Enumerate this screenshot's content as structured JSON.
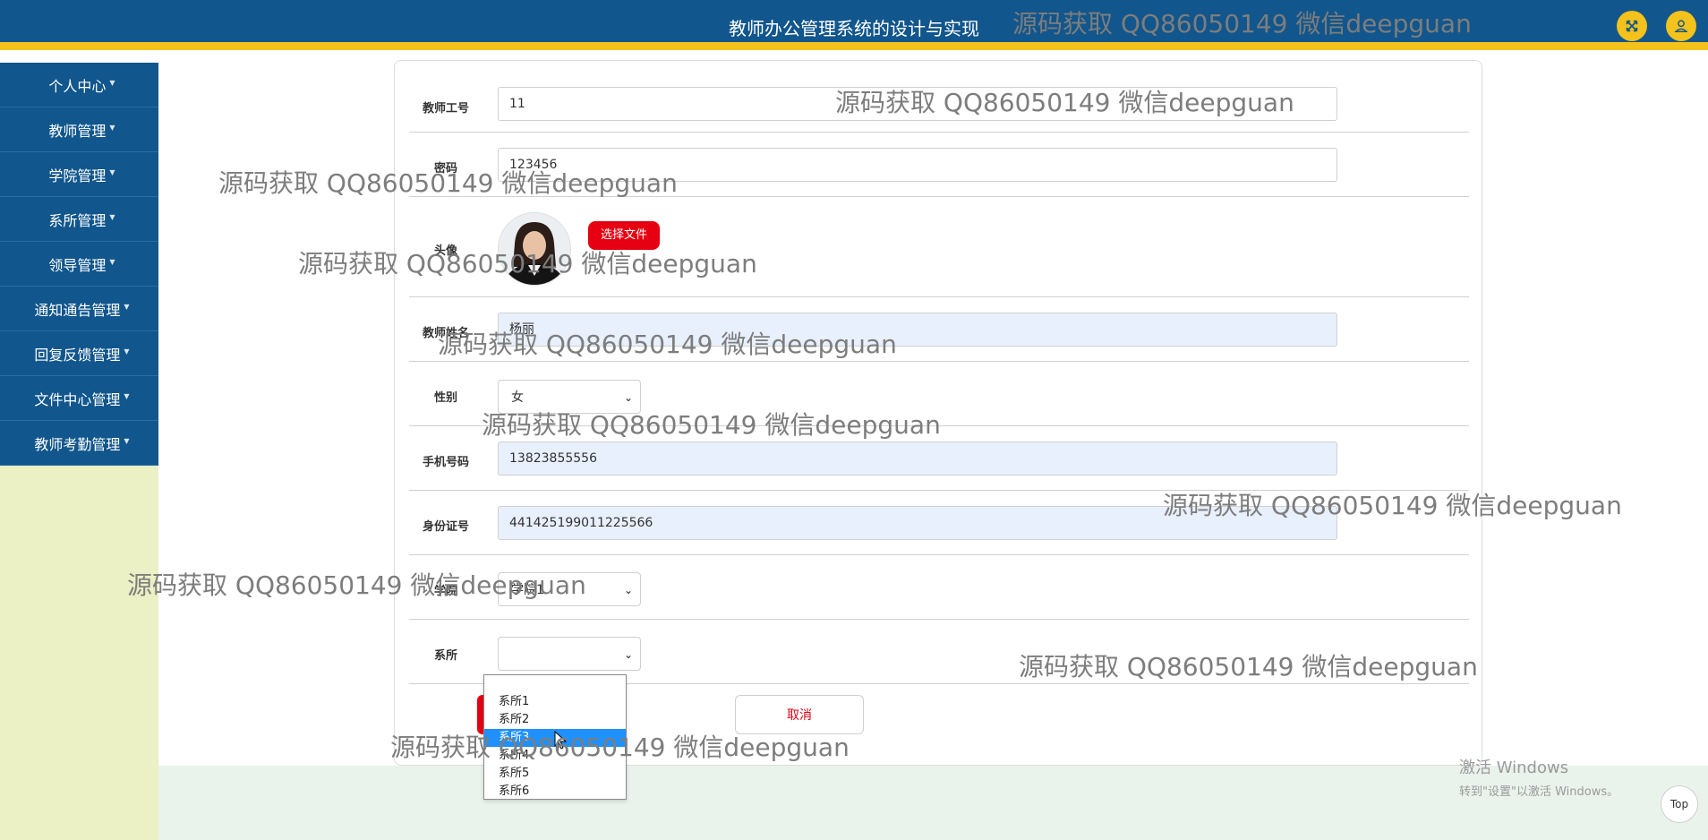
{
  "header": {
    "title": "教师办公管理系统的设计与实现",
    "colors": {
      "bg": "#11568c",
      "accent": "#f3c21b"
    },
    "icons": [
      "fullscreen-icon",
      "user-icon"
    ]
  },
  "sidebar": {
    "items": [
      {
        "label": "个人中心"
      },
      {
        "label": "教师管理"
      },
      {
        "label": "学院管理"
      },
      {
        "label": "系所管理"
      },
      {
        "label": "领导管理"
      },
      {
        "label": "通知通告管理"
      },
      {
        "label": "回复反馈管理"
      },
      {
        "label": "文件中心管理"
      },
      {
        "label": "教师考勤管理"
      }
    ]
  },
  "form": {
    "teacher_id": {
      "label": "教师工号",
      "value": "11"
    },
    "password": {
      "label": "密码",
      "value": "123456"
    },
    "avatar": {
      "label": "头像",
      "button": "选择文件"
    },
    "teacher_name": {
      "label": "教师姓名",
      "value": "杨丽"
    },
    "gender": {
      "label": "性别",
      "value": "女"
    },
    "phone": {
      "label": "手机号码",
      "value": "13823855556"
    },
    "id_card": {
      "label": "身份证号",
      "value": "441425199011225566"
    },
    "college": {
      "label": "学院",
      "value": "学院1"
    },
    "department": {
      "label": "系所",
      "value": "",
      "options": [
        "系所1",
        "系所2",
        "系所3",
        "系所4",
        "系所5",
        "系所6"
      ],
      "highlighted": "系所3"
    },
    "cancel_label": "取消"
  },
  "watermark": "源码获取 QQ86050149 微信deepguan",
  "windows_activation": {
    "title": "激活 Windows",
    "subtitle": "转到\"设置\"以激活 Windows。"
  },
  "top_button": "Top"
}
